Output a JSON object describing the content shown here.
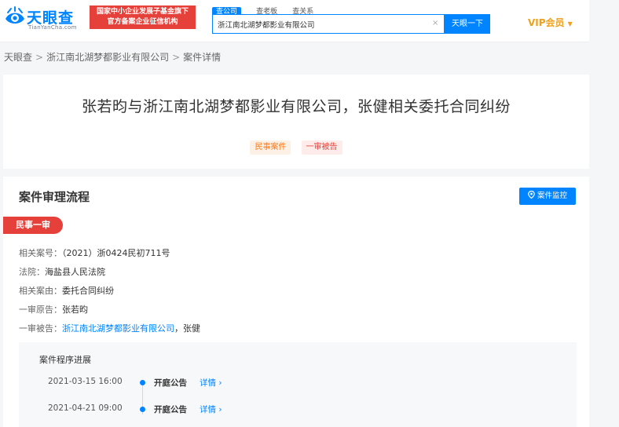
{
  "header": {
    "logo_name": "天眼查",
    "logo_domain": "TianYanCha.com",
    "gov_badge_line1": "国家中小企业发展子基金旗下",
    "gov_badge_line2": "官方备案企业征信机构",
    "search_tabs": [
      "查公司",
      "查老板",
      "查关系"
    ],
    "search_value": "浙江南北湖梦都影业有限公司",
    "clear_glyph": "×",
    "search_button": "天眼一下",
    "vip_label": "VIP会员",
    "vip_caret": "▼",
    "colors": {
      "brand": "#0084ff",
      "badge": "#e5403a",
      "vip": "#f0a11b"
    }
  },
  "breadcrumb": {
    "items": [
      "天眼查",
      "浙江南北湖梦都影业有限公司",
      "案件详情"
    ],
    "separator": ">"
  },
  "case": {
    "title": "张若昀与浙江南北湖梦都影业有限公司，张健相关委托合同纠纷",
    "tags": [
      "民事案件",
      "一审被告"
    ]
  },
  "process": {
    "section_title": "案件审理流程",
    "monitor_button": "案件监控",
    "monitor_icon": "location-pin-icon",
    "stage": "民事一审",
    "details": [
      {
        "label": "相关案号：",
        "value": "（2021）浙0424民初711号"
      },
      {
        "label": "法院：",
        "value": "海盐县人民法院"
      },
      {
        "label": "相关案由：",
        "value": "委托合同纠纷"
      },
      {
        "label": "一审原告：",
        "value": "张若昀"
      },
      {
        "label": "一审被告：",
        "link": "浙江南北湖梦都影业有限公司",
        "value": "，张健"
      }
    ],
    "progress_title": "案件程序进展",
    "events": [
      {
        "date": "2021-03-15 16:00",
        "type": "开庭公告",
        "detail": "详情 ›"
      },
      {
        "date": "2021-04-21 09:00",
        "type": "开庭公告",
        "detail": "详情 ›"
      }
    ]
  }
}
